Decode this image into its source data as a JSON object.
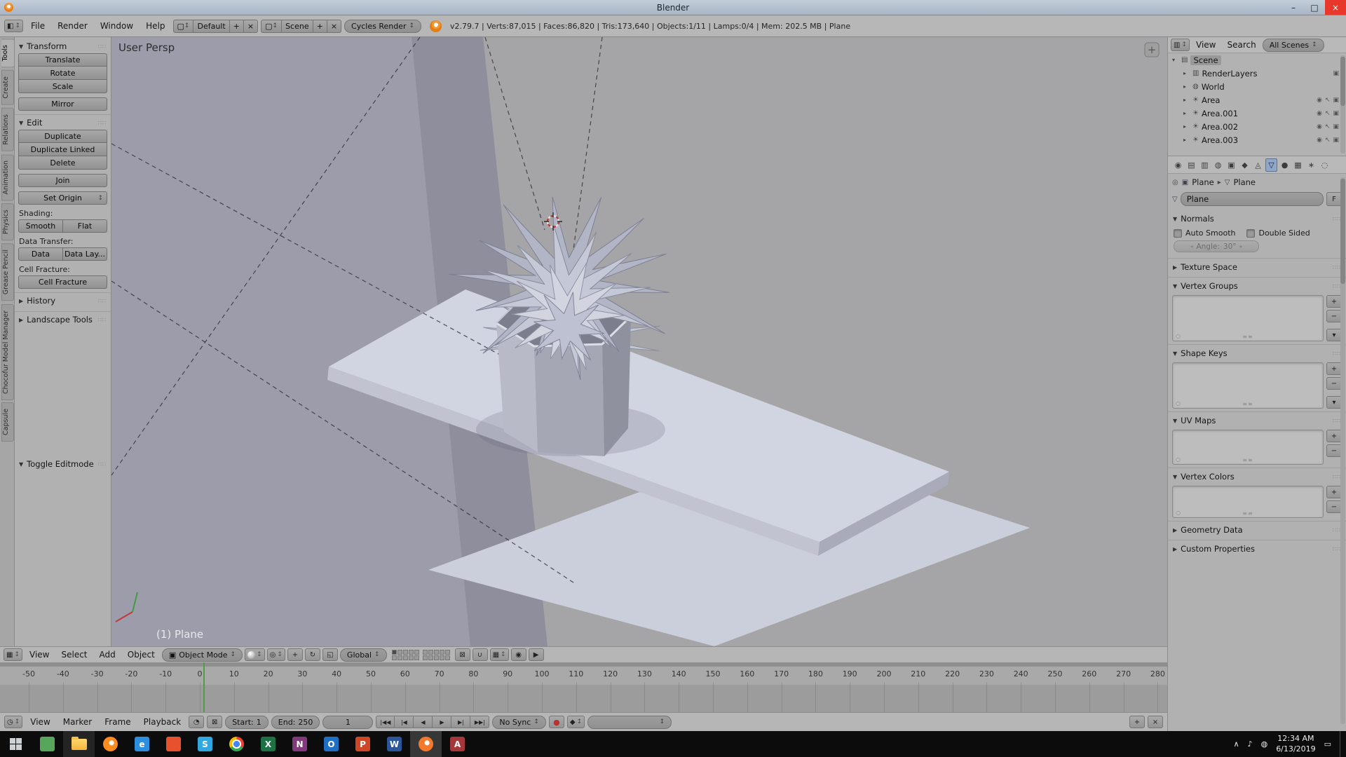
{
  "titlebar": {
    "title": "Blender",
    "minimize": "–",
    "maximize": "□",
    "close": "×"
  },
  "infobar": {
    "menus": [
      "File",
      "Render",
      "Window",
      "Help"
    ],
    "layout_selector": {
      "value": "Default",
      "add_label": "+",
      "delete_label": "×"
    },
    "scene_selector": {
      "value": "Scene",
      "add_label": "+",
      "delete_label": "×"
    },
    "engine_selector": {
      "value": "Cycles Render"
    },
    "stats": "v2.79.7 | Verts:87,015 | Faces:86,820 | Tris:173,640 | Objects:1/11 | Lamps:0/4 | Mem: 202.5 MB | Plane"
  },
  "toolshelf": {
    "tabs": [
      "Tools",
      "Create",
      "Relations",
      "Animation",
      "Physics",
      "Grease Pencil",
      "Chocofur Model Manager",
      "Capsule"
    ],
    "active_tab": "Tools",
    "transform": {
      "title": "Transform",
      "translate": "Translate",
      "rotate": "Rotate",
      "scale": "Scale",
      "mirror": "Mirror"
    },
    "edit": {
      "title": "Edit",
      "duplicate": "Duplicate",
      "duplicate_linked": "Duplicate Linked",
      "delete": "Delete",
      "join": "Join",
      "set_origin": "Set Origin"
    },
    "shading_label": "Shading:",
    "smooth": "Smooth",
    "flat": "Flat",
    "data_transfer_label": "Data Transfer:",
    "data": "Data",
    "data_layout": "Data Lay...",
    "cell_fracture_label": "Cell Fracture:",
    "cell_fracture": "Cell Fracture",
    "history": "History",
    "landscape_tools": "Landscape Tools",
    "toggle_editmode": "Toggle Editmode"
  },
  "viewport": {
    "view_label": "User Persp",
    "status_label": "(1) Plane",
    "header": {
      "menus": [
        "View",
        "Select",
        "Add",
        "Object"
      ],
      "mode": "Object Mode",
      "orientation": "Global"
    }
  },
  "timeline": {
    "ticks": [
      -50,
      -40,
      -30,
      -20,
      -10,
      0,
      10,
      20,
      30,
      40,
      50,
      60,
      70,
      80,
      90,
      100,
      110,
      120,
      130,
      140,
      150,
      160,
      170,
      180,
      190,
      200,
      210,
      220,
      230,
      240,
      250,
      260,
      270,
      280
    ],
    "current_frame": 1,
    "header": {
      "menus": [
        "View",
        "Marker",
        "Frame",
        "Playback"
      ],
      "start_label": "Start:",
      "start_value": "1",
      "end_label": "End:",
      "end_value": "250",
      "frame_value": "1",
      "sync_mode": "No Sync"
    }
  },
  "outliner": {
    "header": {
      "menus": [
        "View",
        "Search"
      ],
      "display_mode": "All Scenes"
    },
    "rows": [
      {
        "label": "Scene",
        "icon": "scene",
        "expanded": true,
        "indent": 0,
        "selected": true,
        "toggles": []
      },
      {
        "label": "RenderLayers",
        "icon": "render-layers",
        "indent": 1,
        "toggles": [
          "renderable"
        ]
      },
      {
        "label": "World",
        "icon": "world",
        "indent": 1,
        "toggles": []
      },
      {
        "label": "Area",
        "icon": "lamp",
        "indent": 1,
        "toggles": [
          "visible",
          "selectable",
          "renderable"
        ]
      },
      {
        "label": "Area.001",
        "icon": "lamp",
        "indent": 1,
        "toggles": [
          "visible",
          "selectable",
          "renderable"
        ]
      },
      {
        "label": "Area.002",
        "icon": "lamp",
        "indent": 1,
        "toggles": [
          "visible",
          "selectable",
          "renderable"
        ]
      },
      {
        "label": "Area.003",
        "icon": "lamp",
        "indent": 1,
        "toggles": [
          "visible",
          "selectable",
          "renderable"
        ]
      }
    ]
  },
  "properties": {
    "tabs": [
      "render",
      "render-layers",
      "scene",
      "world",
      "object",
      "constraints",
      "modifiers",
      "object-data",
      "material",
      "texture",
      "particles",
      "physics"
    ],
    "active_tab": "object-data",
    "breadcrumb": {
      "object": "Plane",
      "data": "Plane"
    },
    "name_value": "Plane",
    "fake_user_label": "F",
    "normals": {
      "title": "Normals",
      "auto_smooth_label": "Auto Smooth",
      "double_sided_label": "Double Sided",
      "angle_label": "Angle:",
      "angle_value": "30°"
    },
    "texture_space_title": "Texture Space",
    "vertex_groups_title": "Vertex Groups",
    "shape_keys_title": "Shape Keys",
    "uv_maps_title": "UV Maps",
    "vertex_colors_title": "Vertex Colors",
    "geometry_data_title": "Geometry Data",
    "custom_properties_title": "Custom Properties"
  },
  "taskbar": {
    "apps": [
      {
        "name": "start"
      },
      {
        "name": "store",
        "color": "#58a55c"
      },
      {
        "name": "file-explorer",
        "color": "#f8c33a",
        "open": true
      },
      {
        "name": "firefox",
        "color": "#ff8a1e"
      },
      {
        "name": "edge",
        "color": "#2e8ede",
        "letter": "e"
      },
      {
        "name": "office",
        "color": "#e8512d"
      },
      {
        "name": "skype",
        "color": "#31a8e0",
        "letter": "S"
      },
      {
        "name": "chrome"
      },
      {
        "name": "excel",
        "color": "#1e7145",
        "letter": "X"
      },
      {
        "name": "onenote",
        "color": "#80397b",
        "letter": "N"
      },
      {
        "name": "outlook",
        "color": "#1f6fc4",
        "letter": "O"
      },
      {
        "name": "powerpoint",
        "color": "#d04727",
        "letter": "P"
      },
      {
        "name": "word",
        "color": "#2b579a",
        "letter": "W"
      },
      {
        "name": "blender",
        "color": "#f5792a",
        "active": true
      },
      {
        "name": "access",
        "color": "#a4373a",
        "letter": "A"
      }
    ],
    "clock": {
      "time": "12:34 AM",
      "date": "6/13/2019"
    }
  },
  "colors": {
    "current_frame": "#4f9e43",
    "selection_highlight": "#8fa8c8"
  }
}
